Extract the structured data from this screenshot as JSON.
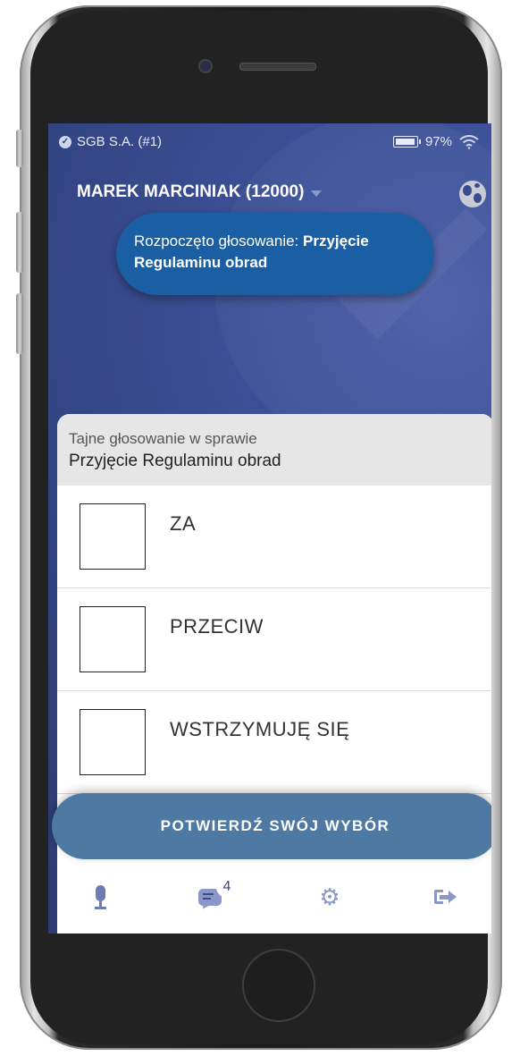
{
  "status_bar": {
    "org": "SGB S.A. (#1)",
    "battery": "97%"
  },
  "header": {
    "user": "MAREK MARCINIAK (12000)"
  },
  "toast": {
    "prefix": "Rozpoczęto głosowanie: ",
    "subject": "Przyjęcie Regulaminu obrad"
  },
  "vote": {
    "subtitle": "Tajne głosowanie w sprawie",
    "title": "Przyjęcie Regulaminu obrad",
    "options": [
      {
        "label": "ZA",
        "checked": false
      },
      {
        "label": "PRZECIW",
        "checked": false
      },
      {
        "label": "WSTRZYMUJĘ SIĘ",
        "checked": false
      }
    ],
    "confirm_label": "POTWIERDŹ SWÓJ WYBÓR"
  },
  "nav": {
    "chat_badge": "4"
  },
  "colors": {
    "background": "#31437f",
    "toast": "#1a5ea3",
    "confirm": "#4d79a3",
    "accent_icon": "#8a97c8"
  }
}
